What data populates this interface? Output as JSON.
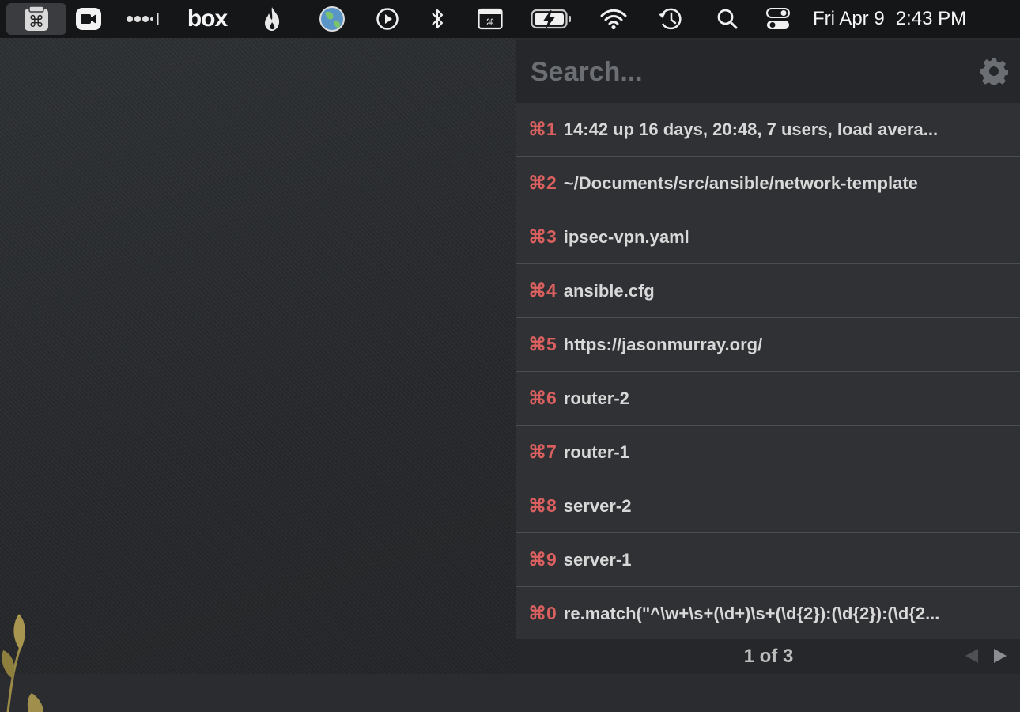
{
  "menubar": {
    "icons": [
      "command-keyboard-icon",
      "video-camera-icon",
      "dots-bar-icon",
      "box-logo",
      "flame-icon",
      "globe-icon",
      "play-circle-icon",
      "bluetooth-icon",
      "window-command-icon",
      "battery-charging-icon",
      "wifi-icon",
      "time-machine-icon",
      "search-icon",
      "control-center-icon"
    ],
    "box_label": "box",
    "date": "Fri Apr 9",
    "time": "2:43 PM"
  },
  "panel": {
    "search_placeholder": "Search...",
    "items": [
      {
        "key": "⌘1",
        "text": "14:42  up 16 days, 20:48, 7 users, load avera..."
      },
      {
        "key": "⌘2",
        "text": "~/Documents/src/ansible/network-template"
      },
      {
        "key": "⌘3",
        "text": "ipsec-vpn.yaml"
      },
      {
        "key": "⌘4",
        "text": "ansible.cfg"
      },
      {
        "key": "⌘5",
        "text": "https://jasonmurray.org/"
      },
      {
        "key": "⌘6",
        "text": "router-2"
      },
      {
        "key": "⌘7",
        "text": "router-1"
      },
      {
        "key": "⌘8",
        "text": "server-2"
      },
      {
        "key": "⌘9",
        "text": "server-1"
      },
      {
        "key": "⌘0",
        "text": "re.match(\"^\\w+\\s+(\\d+)\\s+(\\d{2}):(\\d{2}):(\\d{2..."
      }
    ],
    "pager": "1 of 3"
  },
  "colors": {
    "accent_key": "#d9605f",
    "panel_bg": "#2f3134",
    "menubar_bg": "#151618"
  }
}
